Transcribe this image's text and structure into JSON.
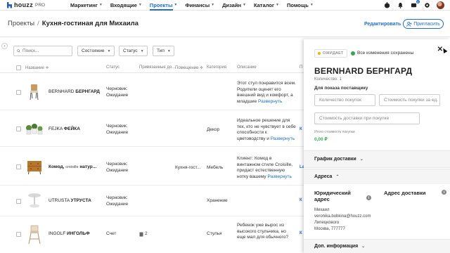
{
  "brand": {
    "logo": "houzz",
    "pro": "PRO"
  },
  "nav": {
    "items": [
      {
        "label": "Маркетинг",
        "active": false
      },
      {
        "label": "Входящие",
        "active": false
      },
      {
        "label": "Проекты",
        "active": true
      },
      {
        "label": "Финансы",
        "active": false
      },
      {
        "label": "Дизайн",
        "active": false
      },
      {
        "label": "Каталог",
        "active": false
      },
      {
        "label": "Помощь",
        "active": false
      }
    ],
    "notification_badge": "8"
  },
  "header": {
    "breadcrumb_root": "Проекты",
    "separator": "/",
    "title": "Кухня-гостиная для Михаила",
    "edit_label": "Редактировать",
    "invite_label": "Пригласить"
  },
  "filters": {
    "search_placeholder": "Поиск...",
    "condition": "Состояние",
    "status": "Статус",
    "type": "Тип"
  },
  "table": {
    "columns": {
      "name": "Название",
      "status": "Статус",
      "linked": "Привязанные до...",
      "room": "Помещение",
      "category": "Категория",
      "description": "Описание",
      "last": "П"
    },
    "rows": [
      {
        "name_pre": "BERNHARD",
        "name_bold": "БЕРНГАРД",
        "status_1": "Черновик:",
        "status_2": "Ожидание",
        "linked": "",
        "room": "",
        "category": "",
        "desc_lines": [
          "Этот стул понравится всем.",
          "Родители оценят его",
          "внешний вид и комфорт, а"
        ],
        "desc_last": "младшие",
        "more": "Развернуть",
        "extra": ""
      },
      {
        "name_pre": "FEJKA",
        "name_bold": "ФЕЙКА",
        "status_1": "Черновик:",
        "status_2": "Ожидание",
        "linked": "",
        "room": "",
        "category": "Декор",
        "desc_lines": [
          "Идеальное решение для",
          "тех, кто не чувствует в себе",
          "способности к"
        ],
        "desc_last": "цветоводству и",
        "more": "Развернуть",
        "extra": "К"
      },
      {
        "name_pre": "Комод,",
        "name_bold": "",
        "name_small": "croisille",
        "name_after": "натур...",
        "status_1": "Черновик:",
        "status_2": "Ожидание",
        "linked": "",
        "room": "Кухня-гост...",
        "category": "Мебель",
        "desc_lines": [
          "Клиент: Комод в",
          "винтажном стиле Croisille,",
          "придаст естественную"
        ],
        "desc_last": "нотку вашему",
        "more": "Развернуть",
        "extra": "La"
      },
      {
        "name_pre": "UTRUSTA",
        "name_bold": "УТРУСТА",
        "status_1": "Черновик:",
        "status_2": "Ожидание",
        "linked": "",
        "room": "",
        "category": "Хранение",
        "desc_lines": [],
        "desc_last": "",
        "more": "",
        "extra": "К"
      },
      {
        "name_pre": "INGOLF",
        "name_bold": "ИНГОЛЬФ",
        "status_1": "Счет",
        "status_2": "",
        "linked": "2",
        "room": "",
        "category": "Стулья",
        "desc_lines": [
          "Ребенок уже вырос из",
          "высокого стульчика, но",
          "еще мал для обычного?"
        ],
        "desc_last": "",
        "more": "",
        "extra": "К"
      }
    ]
  },
  "panel": {
    "status_pill": "ОЖИДАЕТ",
    "saved_text": "Все изменения сохранены",
    "title_pre": "BERNHARD",
    "title_bold": "БЕРНГАРД",
    "quantity": "Количество: 1",
    "supplier_label": "Для показа поставщику",
    "qty_placeholder": "Количество покупок",
    "cost_placeholder": "Стоимость покупки за ед.",
    "shipping_placeholder": "Стоимость доставки при покупке",
    "total_label": "Итого стоимость покупки",
    "total_value": "0,00 ₽",
    "delivery_schedule": "График доставки",
    "addresses": "Адреса",
    "legal_address": "Юридический адрес",
    "delivery_address": "Адрес доставки",
    "addr_lines": [
      "Михаил",
      "veronika.bobkina@houzz.com",
      "Липецкового",
      "Москва, 777777"
    ],
    "extra_info": "Доп. информация"
  }
}
